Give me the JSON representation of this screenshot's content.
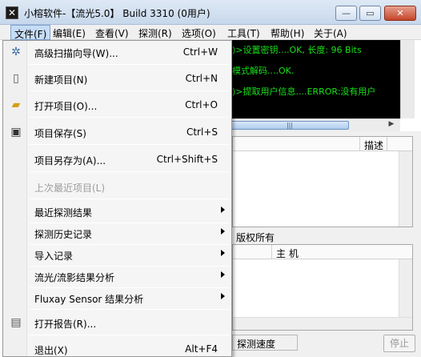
{
  "window": {
    "title": "小榕软件-【流光5.0】 Build 3310 (0用户)",
    "min_glyph": "—",
    "max_glyph": "▭",
    "close_glyph": "✕"
  },
  "menubar": {
    "items": [
      {
        "label": "文件(F)"
      },
      {
        "label": "编辑(E)"
      },
      {
        "label": "查看(V)"
      },
      {
        "label": "探测(R)"
      },
      {
        "label": "选项(O)"
      },
      {
        "label": "工具(T)"
      },
      {
        "label": "帮助(H)"
      },
      {
        "label": "关于(A)"
      }
    ]
  },
  "file_menu": {
    "items": [
      {
        "label": "高级扫描向导(W)...",
        "shortcut": "Ctrl+W",
        "icon": "wizard-icon"
      },
      {
        "label": "新建项目(N)",
        "shortcut": "Ctrl+N",
        "icon": "new-document-icon"
      },
      {
        "label": "打开项目(O)...",
        "shortcut": "Ctrl+O",
        "icon": "open-folder-icon"
      },
      {
        "label": "项目保存(S)",
        "shortcut": "Ctrl+S",
        "icon": "save-disk-icon"
      },
      {
        "label": "项目另存为(A)...",
        "shortcut": "Ctrl+Shift+S"
      },
      {
        "label": "上次最近项目(L)",
        "disabled": true
      },
      {
        "label": "最近探测结果"
      },
      {
        "label": "探测历史记录"
      },
      {
        "label": "导入记录"
      },
      {
        "label": "流光/流影结果分析"
      },
      {
        "label": "Fluxay Sensor 结果分析"
      },
      {
        "label": "打开报告(R)...",
        "icon": "report-icon"
      },
      {
        "label": "退出(X)",
        "shortcut": "Alt+F4"
      }
    ]
  },
  "console": {
    "lines": [
      ")>设置密钥....OK, 长度: 96 Bits",
      "模式解码....OK.",
      ")>提取用户信息....ERROR:没有用户"
    ],
    "text_color": "#18e018",
    "background": "#000000"
  },
  "results_list": {
    "column_header": "描述"
  },
  "copyright_label": "版权所有",
  "host_list": {
    "column_header": "主 机"
  },
  "status": {
    "probe_speed_label": "探测速度",
    "stop_button": "停止"
  },
  "scroll_glyphs": {
    "thumb_grip": "|||",
    "right_arrow": "▶"
  }
}
